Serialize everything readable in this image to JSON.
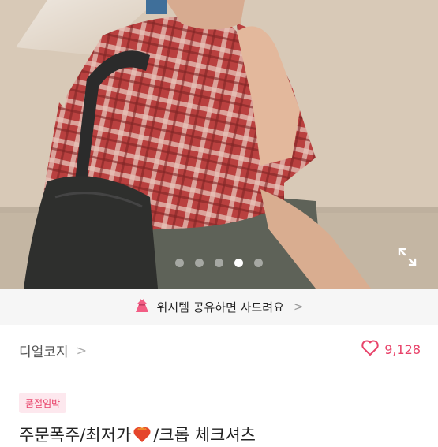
{
  "product_photo": {
    "description": "",
    "carousel_total": 5,
    "carousel_active": 4
  },
  "promo_banner": {
    "text": "위시템 공유하면 사드려요",
    "icon": "dress-icon",
    "chevron": ">"
  },
  "seller": {
    "name": "디얼코지",
    "chevron": ">"
  },
  "likes": {
    "count": "9,128",
    "icon": "heart-outline-icon"
  },
  "badge": {
    "label": "품절임박"
  },
  "product": {
    "title_part1": "주문폭주/최저가",
    "title_part2": "/크롭 체크셔츠",
    "title_icon": "fire-heart-icon"
  },
  "colors": {
    "accent": "#e8436a",
    "badge_bg": "#fde8ee",
    "banner_bg": "#f6f6f6"
  }
}
